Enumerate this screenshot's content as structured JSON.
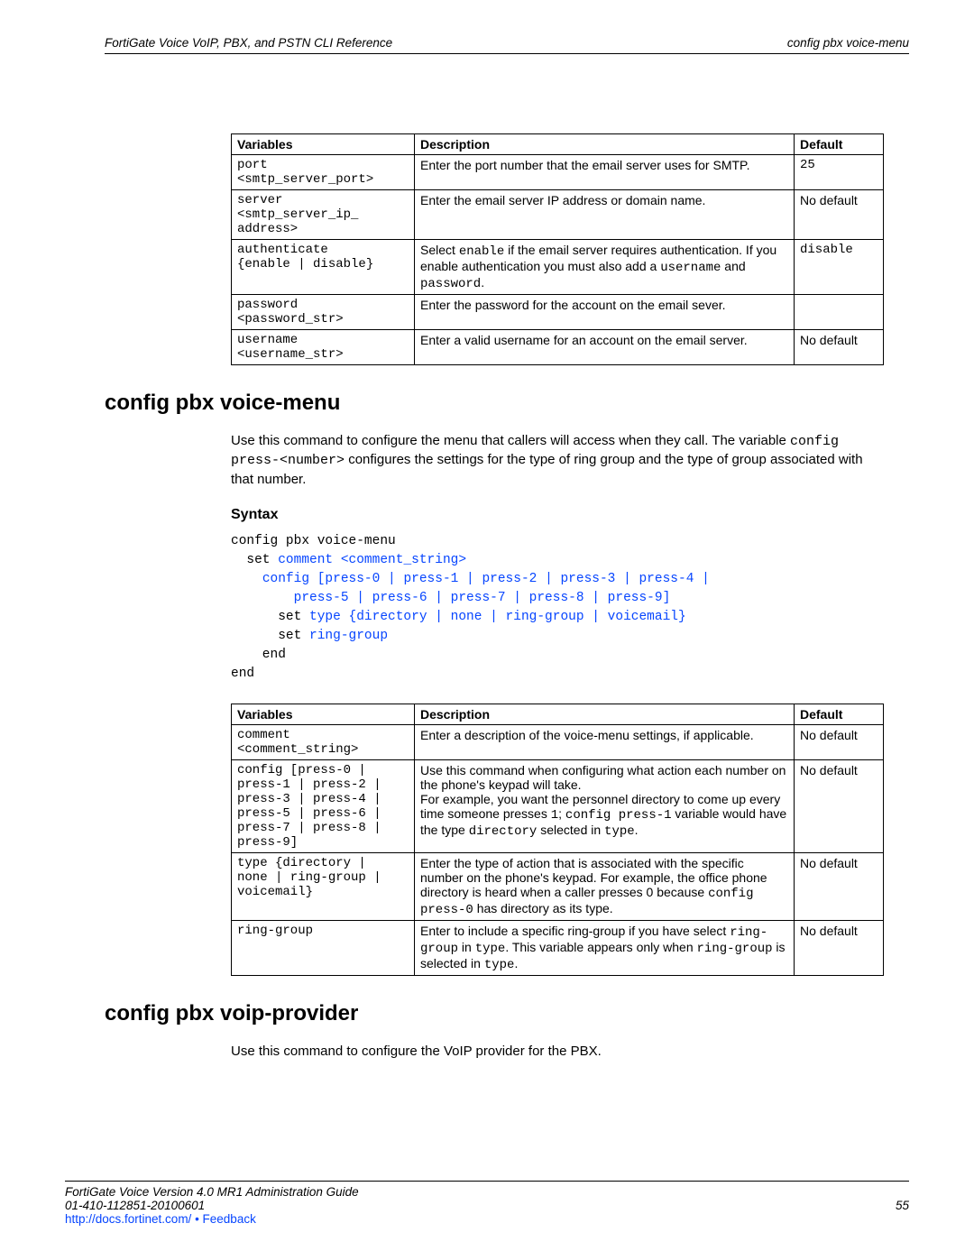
{
  "header": {
    "left": "FortiGate Voice VoIP, PBX, and PSTN CLI Reference",
    "right": "config pbx voice-menu"
  },
  "table1": {
    "headers": {
      "c1": "Variables",
      "c2": "Description",
      "c3": "Default"
    },
    "rows": [
      {
        "c1": "port\n<smtp_server_port>",
        "c2": "Enter the port number that the email server uses for SMTP.",
        "c3": "25",
        "c3mono": true
      },
      {
        "c1": "server\n<smtp_server_ip_\naddress>",
        "c2": "Enter the email server IP address or domain name.",
        "c3": "No default"
      },
      {
        "c1": "authenticate\n{enable | disable}",
        "c2_html": "Select <span class='mono'>enable</span> if the email server requires authentication. If you enable authentication you must also add a <span class='mono'>username</span> and <span class='mono'>password</span>.",
        "c3": "disable",
        "c3mono": true
      },
      {
        "c1": "password\n<password_str>",
        "c2": "Enter the password for the account on the email sever.",
        "c3": ""
      },
      {
        "c1": "username\n<username_str>",
        "c2": "Enter a valid username for an account on the email server.",
        "c3": "No default"
      }
    ]
  },
  "section1": {
    "title": "config pbx voice-menu",
    "intro_html": "Use this command to configure the menu that callers will access when they call. The variable <span class='mono'>config press-&lt;number&gt;</span> configures the settings for the type of ring group and the type of group associated with that number.",
    "syntax_label": "Syntax",
    "code": {
      "l1": "config pbx voice-menu",
      "l2a": "  set ",
      "l2b": "comment <comment_string>",
      "l3a": "    ",
      "l3b": "config [press-0 | press-1 | press-2 | press-3 | press-4 |",
      "l4": "        press-5 | press-6 | press-7 | press-8 | press-9]",
      "l5a": "      set ",
      "l5b": "type {directory | none | ring-group | voicemail}",
      "l6a": "      set ",
      "l6b": "ring-group",
      "l7": "    end",
      "l8": "end"
    }
  },
  "table2": {
    "headers": {
      "c1": "Variables",
      "c2": "Description",
      "c3": "Default"
    },
    "rows": [
      {
        "c1": "comment\n<comment_string>",
        "c2": "Enter a description of the voice-menu settings, if applicable.",
        "c3": "No default"
      },
      {
        "c1": "config [press-0 |\npress-1 | press-2 |\npress-3 | press-4 |\npress-5 | press-6 |\npress-7 | press-8 |\npress-9]",
        "c2_html": "Use this command when configuring what action each number on the phone's keypad will take.<br>For example, you want the personnel directory to come up every time someone presses <span class='mono'>1</span>; <span class='mono'>config press-1</span> variable would have the type <span class='mono'>directory</span> selected in <span class='mono'>type</span>.",
        "c3": "No default"
      },
      {
        "c1": "type {directory |\nnone | ring-group |\nvoicemail}",
        "c2_html": "Enter the type of action that is associated with the specific number on the phone's keypad. For example, the office phone directory is heard when a caller presses 0 because <span class='mono'>config press-0</span> has directory as its type.",
        "c3": "No default"
      },
      {
        "c1": "ring-group",
        "c2_html": "Enter to include a specific ring-group if you have select <span class='mono'>ring-group</span> in <span class='mono'>type</span>. This variable appears only when <span class='mono'>ring-group</span> is selected in <span class='mono'>type</span>.",
        "c3": "No default"
      }
    ]
  },
  "section2": {
    "title": "config pbx voip-provider",
    "intro": "Use this command to configure the VoIP provider for the PBX."
  },
  "footer": {
    "line1": "FortiGate Voice Version 4.0 MR1 Administration Guide",
    "line2_left": "01-410-112851-20100601",
    "line2_right": "55",
    "link": "http://docs.fortinet.com/ • Feedback"
  }
}
